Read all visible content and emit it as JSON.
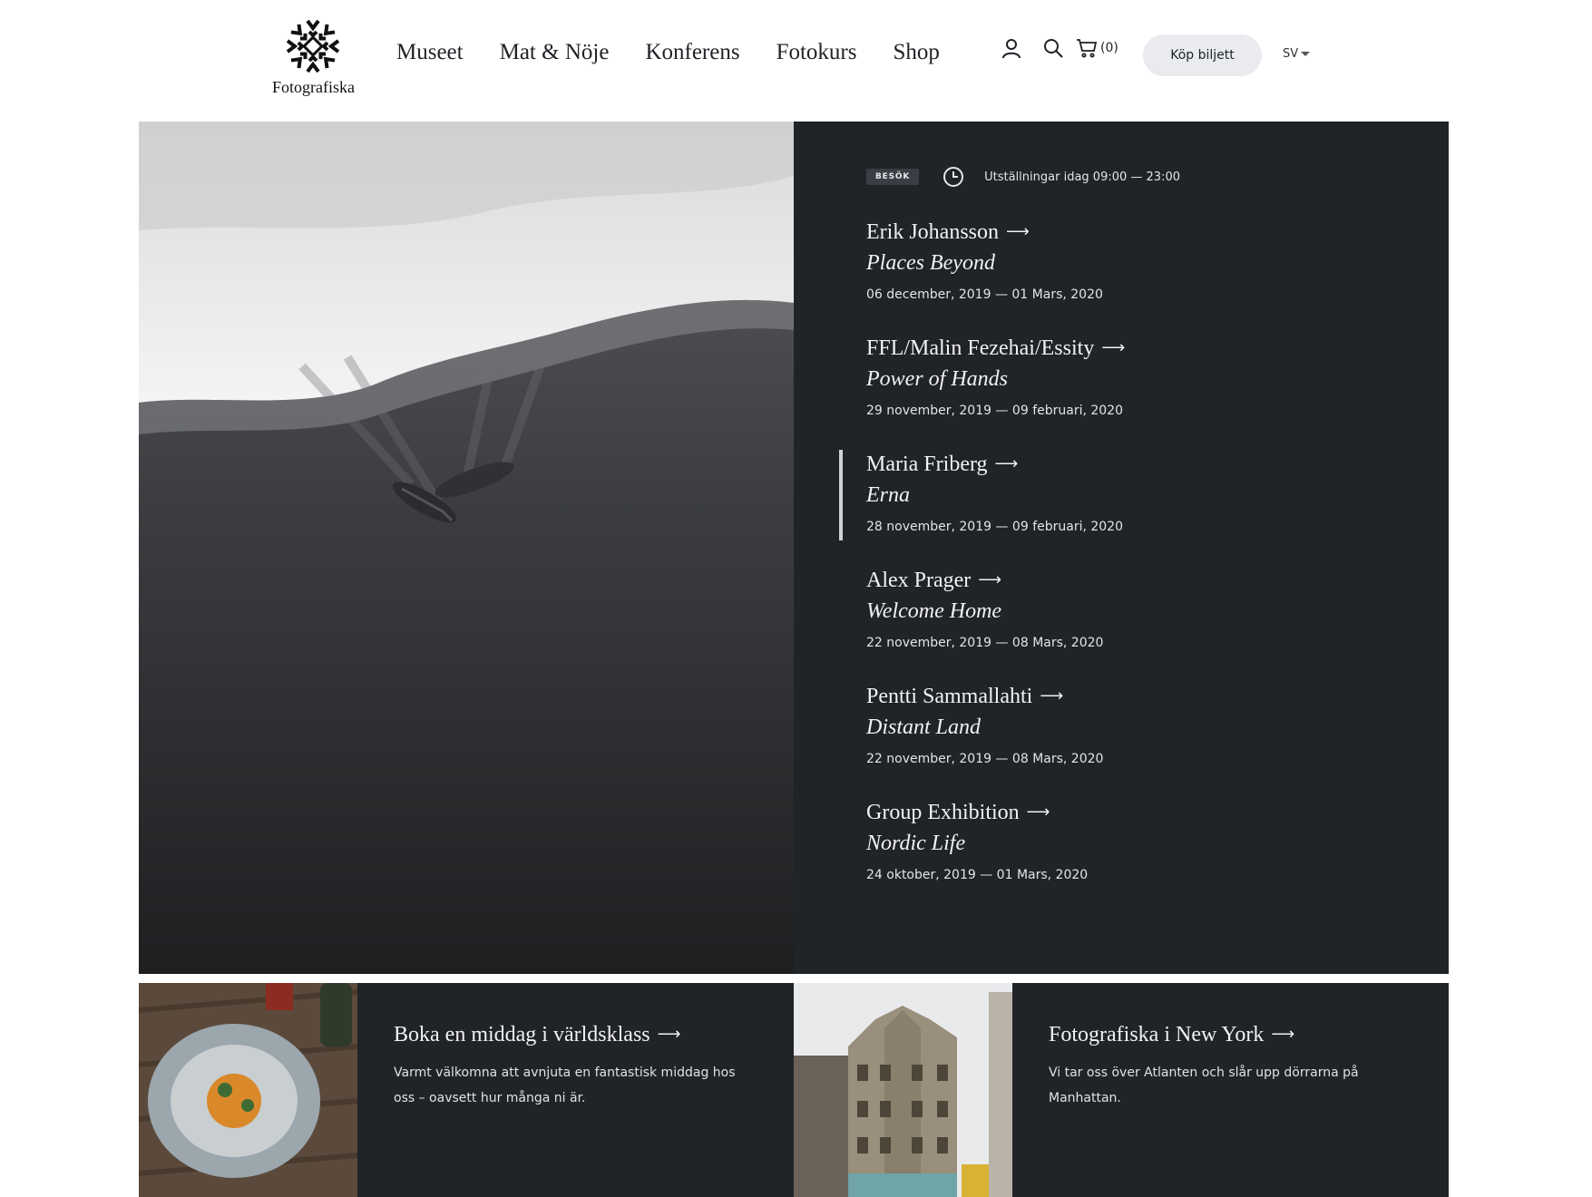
{
  "header": {
    "logo_text": "Fotografiska",
    "nav": [
      "Museet",
      "Mat & Nöje",
      "Konferens",
      "Fotokurs",
      "Shop"
    ],
    "account_icon": "user-icon",
    "search_icon": "search-icon",
    "cart_icon": "cart-icon",
    "cart_count": "(0)",
    "ticket_button": "Köp biljett",
    "language": "SV"
  },
  "hero": {
    "badge": "BESÖK",
    "clock_icon": "clock-icon",
    "hours": "Utställningar idag 09:00 — 23:00",
    "exhibitions": [
      {
        "artist": "Erik Johansson",
        "title": "Places Beyond",
        "dates": "06 december, 2019 — 01 Mars, 2020"
      },
      {
        "artist": "FFL/Malin Fezehai/Essity",
        "title": "Power of Hands",
        "dates": "29 november, 2019 — 09 februari, 2020"
      },
      {
        "artist": "Maria Friberg",
        "title": "Erna",
        "dates": "28 november, 2019 — 09 februari, 2020"
      },
      {
        "artist": "Alex Prager",
        "title": "Welcome Home",
        "dates": "22 november, 2019 — 08 Mars, 2020"
      },
      {
        "artist": "Pentti Sammallahti",
        "title": "Distant Land",
        "dates": "22 november, 2019 — 08 Mars, 2020"
      },
      {
        "artist": "Group Exhibition",
        "title": "Nordic Life",
        "dates": "24 oktober, 2019 — 01 Mars, 2020"
      }
    ],
    "arrow": "⟶"
  },
  "cards": [
    {
      "title": "Boka en middag i världsklass",
      "desc": "Varmt välkomna att avnjuta en fantastisk middag hos oss – oavsett hur många ni är."
    },
    {
      "title": "Fotografiska i New York",
      "desc": "Vi tar oss över Atlanten och slår upp dörrarna på Manhattan."
    }
  ],
  "colors": {
    "panel": "#202328",
    "button_bg": "#e9ebee",
    "text_dark": "#1f2226"
  }
}
